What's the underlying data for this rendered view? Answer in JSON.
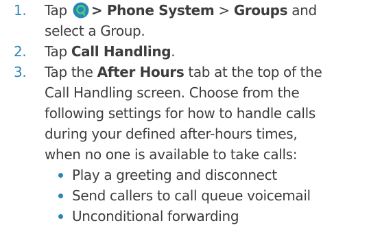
{
  "steps": [
    {
      "number": "1.",
      "lines": [
        {
          "pre": "Tap",
          "bold1": "> Phone System",
          "mid": ">",
          "bold2": "Groups",
          "post": "and"
        },
        {
          "text": "select a Group."
        }
      ]
    },
    {
      "number": "2.",
      "pre": "Tap",
      "bold": "Call Handling",
      "post": "."
    },
    {
      "number": "3.",
      "line1": {
        "pre": "Tap the",
        "bold": "After Hours",
        "post": "tab at the top of the"
      },
      "lines": [
        "Call Handling screen. Choose from the",
        "following settings for how to handle calls",
        "during your defined after-hours times,",
        "when no one is available to take calls:"
      ],
      "bullets": [
        "Play a greeting and disconnect",
        "Send callers to call queue voicemail",
        "Unconditional forwarding"
      ]
    }
  ],
  "icons": {
    "app_icon": "phone-app-icon"
  },
  "colors": {
    "text": "#3d3d3d",
    "accent": "#2b86b8",
    "icon_bg": "#2b86b8",
    "icon_fg": "#4ad07a"
  }
}
